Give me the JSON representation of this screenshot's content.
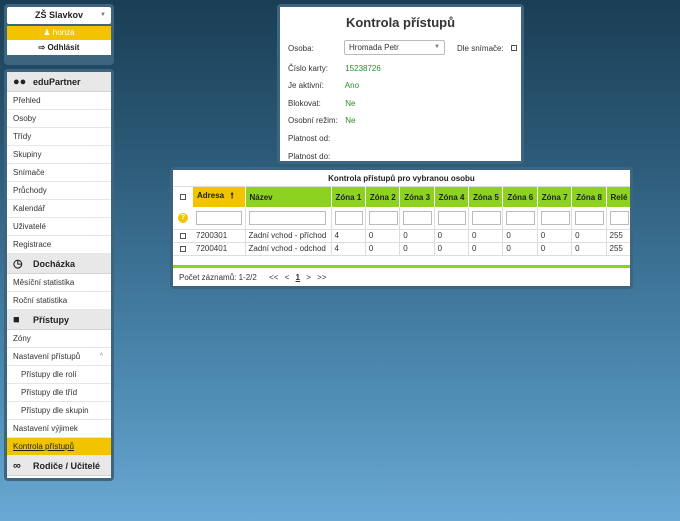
{
  "user": {
    "school": "ZŠ Slavkov",
    "username": "honza",
    "logout": "Odhlásit"
  },
  "nav": {
    "edupartner": {
      "title": "eduPartner",
      "items": [
        "Přehled",
        "Osoby",
        "Třídy",
        "Skupiny",
        "Snímače",
        "Průchody",
        "Kalendář",
        "Uživatelé",
        "Registrace"
      ]
    },
    "dochazka": {
      "title": "Docházka",
      "items": [
        "Měsíční statistika",
        "Roční statistika"
      ]
    },
    "pristupy": {
      "title": "Přístupy",
      "items": [
        "Zóny",
        "Nastavení přístupů"
      ],
      "subitems": [
        "Přístupy dle rolí",
        "Přístupy dle tříd",
        "Přístupy dle skupin"
      ],
      "after": [
        "Nastavení výjimek",
        "Kontrola přístupů"
      ]
    },
    "rodice": {
      "title": "Rodiče / Učitelé"
    }
  },
  "access_check": {
    "title": "Kontrola přístupů",
    "person_label": "Osoba:",
    "person_value": "Hromada Petr",
    "reader_label": "Dle snímače:",
    "card_label": "Číslo karty:",
    "card_value": "15238726",
    "active_label": "Je aktivní:",
    "active_value": "Ano",
    "block_label": "Blokovat:",
    "block_value": "Ne",
    "personal_label": "Osobní režim:",
    "personal_value": "Ne",
    "valid_from_label": "Platnost od:",
    "valid_to_label": "Platnost do:"
  },
  "table": {
    "title": "Kontrola přístupů pro vybranou osobu",
    "columns": [
      "Adresa",
      "Název",
      "Zóna 1",
      "Zóna 2",
      "Zóna 3",
      "Zóna 4",
      "Zóna 5",
      "Zóna 6",
      "Zóna 7",
      "Zóna 8",
      "Relé"
    ],
    "rows": [
      [
        "7200301",
        "Zadní vchod - příchod",
        "4",
        "0",
        "0",
        "0",
        "0",
        "0",
        "0",
        "0",
        "255"
      ],
      [
        "7200401",
        "Zadní vchod - odchod",
        "4",
        "0",
        "0",
        "0",
        "0",
        "0",
        "0",
        "0",
        "255"
      ]
    ],
    "record_count": "Počet záznamů: 1-2/2",
    "pager": [
      "<<",
      "<",
      "1",
      ">",
      ">>"
    ]
  },
  "colors": {
    "accent_yellow": "#f2c400",
    "accent_green": "#8dd21e",
    "value_green": "#2a8a2a"
  }
}
